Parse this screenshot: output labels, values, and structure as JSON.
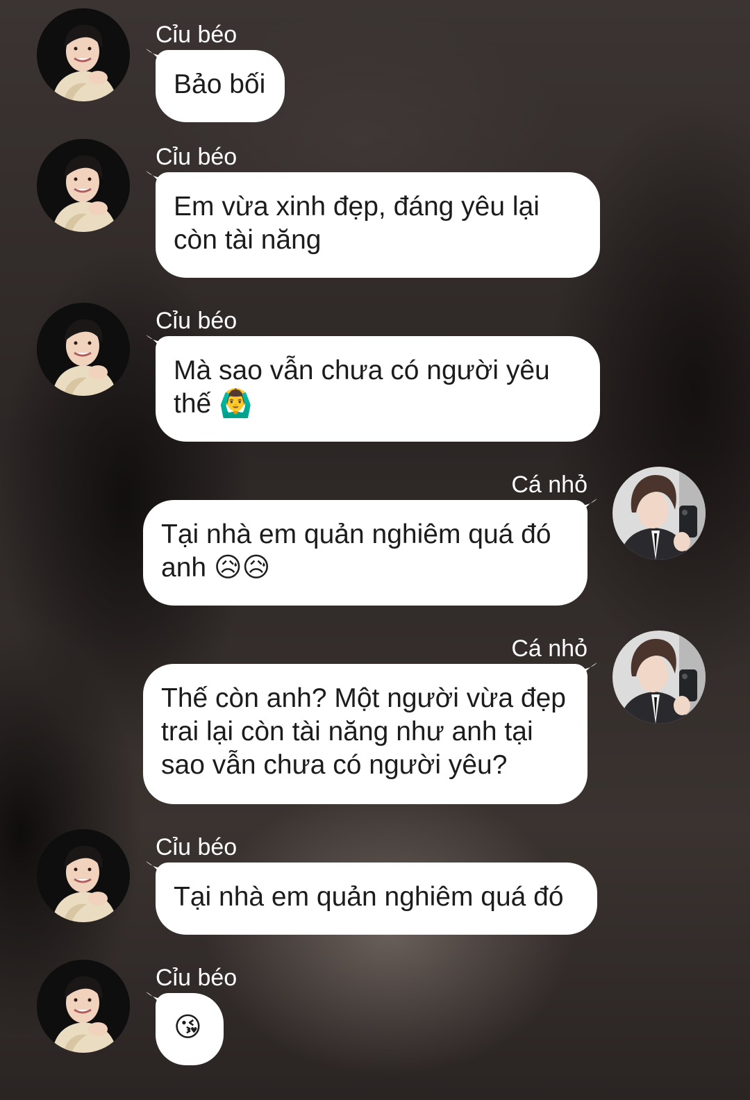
{
  "participants": {
    "left": {
      "name": "Cỉu béo",
      "avatar_icon": "avatar-man-smiling-icon"
    },
    "right": {
      "name": "Cá nhỏ",
      "avatar_icon": "avatar-boy-selfie-icon"
    }
  },
  "messages": [
    {
      "sender": "Cỉu béo",
      "side": "left",
      "text": "Bảo bối"
    },
    {
      "sender": "Cỉu béo",
      "side": "left",
      "text": "Em vừa xinh đẹp, đáng yêu lại còn tài năng"
    },
    {
      "sender": "Cỉu béo",
      "side": "left",
      "text": "Mà sao vẫn chưa có người yêu thế 🙆‍♂️"
    },
    {
      "sender": "Cá nhỏ",
      "side": "right",
      "text": "Tại nhà em quản nghiêm quá đó anh 😥😥"
    },
    {
      "sender": "Cá nhỏ",
      "side": "right",
      "text": "Thế còn anh? Một người vừa đẹp trai lại còn tài năng như anh tại sao vẫn chưa có người yêu?"
    },
    {
      "sender": "Cỉu béo",
      "side": "left",
      "text": "Tại nhà em quản nghiêm quá đó"
    },
    {
      "sender": "Cỉu béo",
      "side": "left",
      "text": "😘"
    }
  ],
  "colors": {
    "bubble": "#ffffff",
    "bubble_text": "#1c1c1c",
    "name_text": "#ffffff"
  }
}
